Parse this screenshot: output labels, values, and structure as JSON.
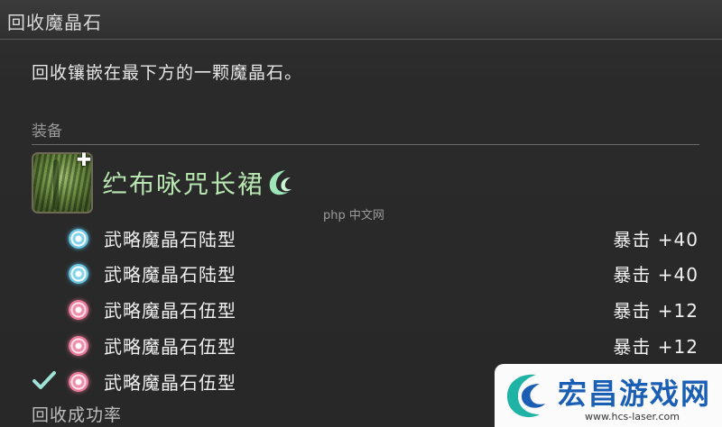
{
  "window": {
    "title": "回收魔晶石"
  },
  "description": "回收镶嵌在最下方的一颗魔晶石。",
  "equipment_section": {
    "label": "装备"
  },
  "item": {
    "name": "纻布咏咒长裙",
    "icon": "dress-item-icon",
    "quality_icon": "high-quality-icon"
  },
  "materia": [
    {
      "name": "武略魔晶石陆型",
      "stat": "暴击 +40",
      "gem_color": "#6cc6e4",
      "selected": false
    },
    {
      "name": "武略魔晶石陆型",
      "stat": "暴击 +40",
      "gem_color": "#6cc6e4",
      "selected": false
    },
    {
      "name": "武略魔晶石伍型",
      "stat": "暴击 +12",
      "gem_color": "#e77c98",
      "selected": false
    },
    {
      "name": "武略魔晶石伍型",
      "stat": "暴击 +12",
      "gem_color": "#e77c98",
      "selected": false
    },
    {
      "name": "武略魔晶石伍型",
      "stat": "",
      "gem_color": "#e77c98",
      "selected": true
    }
  ],
  "success_rate_label": "回收成功率",
  "watermark": {
    "text": "宏昌游戏网",
    "url": "www.hcs-laser.com"
  },
  "php_mark": "php 中文网"
}
